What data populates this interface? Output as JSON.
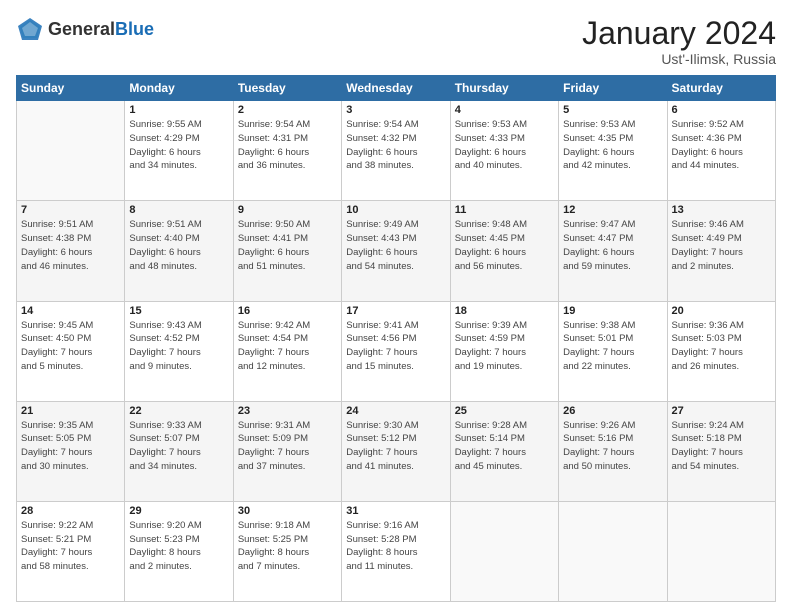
{
  "header": {
    "logo_general": "General",
    "logo_blue": "Blue",
    "month_title": "January 2024",
    "location": "Ust'-Ilimsk, Russia"
  },
  "weekdays": [
    "Sunday",
    "Monday",
    "Tuesday",
    "Wednesday",
    "Thursday",
    "Friday",
    "Saturday"
  ],
  "weeks": [
    [
      {
        "day": "",
        "info": ""
      },
      {
        "day": "1",
        "info": "Sunrise: 9:55 AM\nSunset: 4:29 PM\nDaylight: 6 hours\nand 34 minutes."
      },
      {
        "day": "2",
        "info": "Sunrise: 9:54 AM\nSunset: 4:31 PM\nDaylight: 6 hours\nand 36 minutes."
      },
      {
        "day": "3",
        "info": "Sunrise: 9:54 AM\nSunset: 4:32 PM\nDaylight: 6 hours\nand 38 minutes."
      },
      {
        "day": "4",
        "info": "Sunrise: 9:53 AM\nSunset: 4:33 PM\nDaylight: 6 hours\nand 40 minutes."
      },
      {
        "day": "5",
        "info": "Sunrise: 9:53 AM\nSunset: 4:35 PM\nDaylight: 6 hours\nand 42 minutes."
      },
      {
        "day": "6",
        "info": "Sunrise: 9:52 AM\nSunset: 4:36 PM\nDaylight: 6 hours\nand 44 minutes."
      }
    ],
    [
      {
        "day": "7",
        "info": "Sunrise: 9:51 AM\nSunset: 4:38 PM\nDaylight: 6 hours\nand 46 minutes."
      },
      {
        "day": "8",
        "info": "Sunrise: 9:51 AM\nSunset: 4:40 PM\nDaylight: 6 hours\nand 48 minutes."
      },
      {
        "day": "9",
        "info": "Sunrise: 9:50 AM\nSunset: 4:41 PM\nDaylight: 6 hours\nand 51 minutes."
      },
      {
        "day": "10",
        "info": "Sunrise: 9:49 AM\nSunset: 4:43 PM\nDaylight: 6 hours\nand 54 minutes."
      },
      {
        "day": "11",
        "info": "Sunrise: 9:48 AM\nSunset: 4:45 PM\nDaylight: 6 hours\nand 56 minutes."
      },
      {
        "day": "12",
        "info": "Sunrise: 9:47 AM\nSunset: 4:47 PM\nDaylight: 6 hours\nand 59 minutes."
      },
      {
        "day": "13",
        "info": "Sunrise: 9:46 AM\nSunset: 4:49 PM\nDaylight: 7 hours\nand 2 minutes."
      }
    ],
    [
      {
        "day": "14",
        "info": "Sunrise: 9:45 AM\nSunset: 4:50 PM\nDaylight: 7 hours\nand 5 minutes."
      },
      {
        "day": "15",
        "info": "Sunrise: 9:43 AM\nSunset: 4:52 PM\nDaylight: 7 hours\nand 9 minutes."
      },
      {
        "day": "16",
        "info": "Sunrise: 9:42 AM\nSunset: 4:54 PM\nDaylight: 7 hours\nand 12 minutes."
      },
      {
        "day": "17",
        "info": "Sunrise: 9:41 AM\nSunset: 4:56 PM\nDaylight: 7 hours\nand 15 minutes."
      },
      {
        "day": "18",
        "info": "Sunrise: 9:39 AM\nSunset: 4:59 PM\nDaylight: 7 hours\nand 19 minutes."
      },
      {
        "day": "19",
        "info": "Sunrise: 9:38 AM\nSunset: 5:01 PM\nDaylight: 7 hours\nand 22 minutes."
      },
      {
        "day": "20",
        "info": "Sunrise: 9:36 AM\nSunset: 5:03 PM\nDaylight: 7 hours\nand 26 minutes."
      }
    ],
    [
      {
        "day": "21",
        "info": "Sunrise: 9:35 AM\nSunset: 5:05 PM\nDaylight: 7 hours\nand 30 minutes."
      },
      {
        "day": "22",
        "info": "Sunrise: 9:33 AM\nSunset: 5:07 PM\nDaylight: 7 hours\nand 34 minutes."
      },
      {
        "day": "23",
        "info": "Sunrise: 9:31 AM\nSunset: 5:09 PM\nDaylight: 7 hours\nand 37 minutes."
      },
      {
        "day": "24",
        "info": "Sunrise: 9:30 AM\nSunset: 5:12 PM\nDaylight: 7 hours\nand 41 minutes."
      },
      {
        "day": "25",
        "info": "Sunrise: 9:28 AM\nSunset: 5:14 PM\nDaylight: 7 hours\nand 45 minutes."
      },
      {
        "day": "26",
        "info": "Sunrise: 9:26 AM\nSunset: 5:16 PM\nDaylight: 7 hours\nand 50 minutes."
      },
      {
        "day": "27",
        "info": "Sunrise: 9:24 AM\nSunset: 5:18 PM\nDaylight: 7 hours\nand 54 minutes."
      }
    ],
    [
      {
        "day": "28",
        "info": "Sunrise: 9:22 AM\nSunset: 5:21 PM\nDaylight: 7 hours\nand 58 minutes."
      },
      {
        "day": "29",
        "info": "Sunrise: 9:20 AM\nSunset: 5:23 PM\nDaylight: 8 hours\nand 2 minutes."
      },
      {
        "day": "30",
        "info": "Sunrise: 9:18 AM\nSunset: 5:25 PM\nDaylight: 8 hours\nand 7 minutes."
      },
      {
        "day": "31",
        "info": "Sunrise: 9:16 AM\nSunset: 5:28 PM\nDaylight: 8 hours\nand 11 minutes."
      },
      {
        "day": "",
        "info": ""
      },
      {
        "day": "",
        "info": ""
      },
      {
        "day": "",
        "info": ""
      }
    ]
  ]
}
